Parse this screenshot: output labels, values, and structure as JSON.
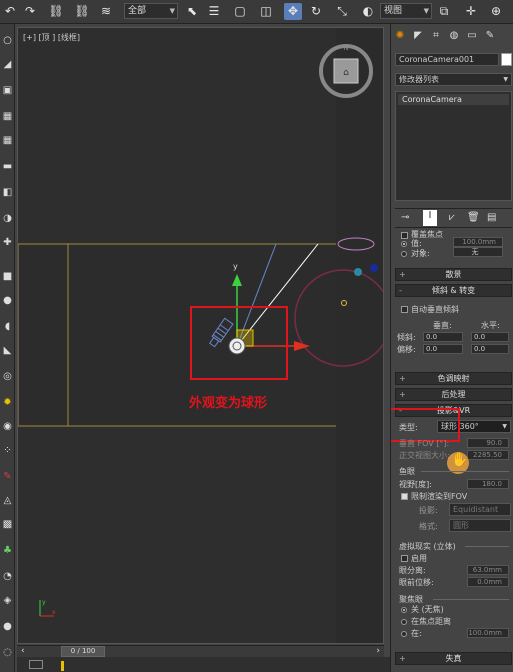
{
  "toolbar": {
    "selection_filter": "全部",
    "reference_coord": "视图",
    "icons": [
      "undo-icon",
      "redo-icon",
      "link-icon",
      "unlink-icon",
      "bind-space-warp-icon",
      "select-object-icon",
      "select-by-name-icon",
      "rectangle-selection-icon",
      "window-crossing-icon",
      "move-icon",
      "rotate-icon",
      "scale-icon",
      "pivot-center-icon",
      "snap-toggle-icon",
      "move-gizmo-icon"
    ]
  },
  "viewport": {
    "label": "[+] [顶 ] [线框]",
    "annotation": "外观变为球形",
    "colors": {
      "annotation_red": "#e0141c",
      "camera_blue": "#6a86c8",
      "safe_frame": "#a08a3c",
      "target_line": "#ffffff"
    }
  },
  "timeline": {
    "frame": "0 / 100"
  },
  "panel": {
    "tabs": [
      "create-icon",
      "modify-icon",
      "hierarchy-icon",
      "motion-icon",
      "display-icon",
      "utilities-icon"
    ],
    "object_name": "CoronaCamera001",
    "modifier_list": "修改器列表",
    "stack_items": [
      "CoronaCamera"
    ],
    "stack_tools": [
      "pin-stack-icon",
      "show-end-result-icon",
      "make-unique-icon",
      "remove-modifier-icon",
      "configure-sets-icon"
    ],
    "focus": {
      "header": "覆盖焦点",
      "value_label": "值:",
      "value": "100.0mm",
      "object_label": "对象:",
      "object_value": "无"
    },
    "rollouts": {
      "scene": "散景",
      "tilt_shift": "倾斜 & 转变",
      "tone_mapping": "色调映射",
      "post_processing": "后处理",
      "projection_vr": "投影&VR",
      "lens": "失真"
    },
    "tilt": {
      "auto_vertical": "自动垂直倾斜",
      "vertical": "垂直:",
      "horizontal": "水平:",
      "tilt_label": "倾斜:",
      "tilt_v": "0.0",
      "tilt_h": "0.0",
      "shift_label": "偏移:",
      "shift_v": "0.0",
      "shift_h": "0.0"
    },
    "projection": {
      "type_label": "类型:",
      "type_value": "球形 360°",
      "vfov_label": "垂直 FOV [°]:",
      "vfov_value": "90.0",
      "ortho_label": "正交视图大小:",
      "ortho_value": "2285.50",
      "fisheye_header": "鱼眼",
      "fov_label": "视野[度]:",
      "fov_value": "180.0",
      "limit_fov": "限制渲染到FOV",
      "proj_label": "投影:",
      "proj_value": "Equidistant",
      "format_label": "格式:",
      "format_value": "圆形"
    },
    "vr": {
      "header": "虚拟现实 (立体)",
      "enable": "启用",
      "eye_sep_label": "眼分离:",
      "eye_sep_value": "63.0mm",
      "front_offset_label": "眼前位移:",
      "front_offset_value": "0.0mm"
    },
    "focus_point": {
      "header": "聚焦眼",
      "none": "关 (无焦)",
      "at_point": "在焦点距离",
      "at_label": "在:",
      "at_value": "100.0mm"
    }
  }
}
